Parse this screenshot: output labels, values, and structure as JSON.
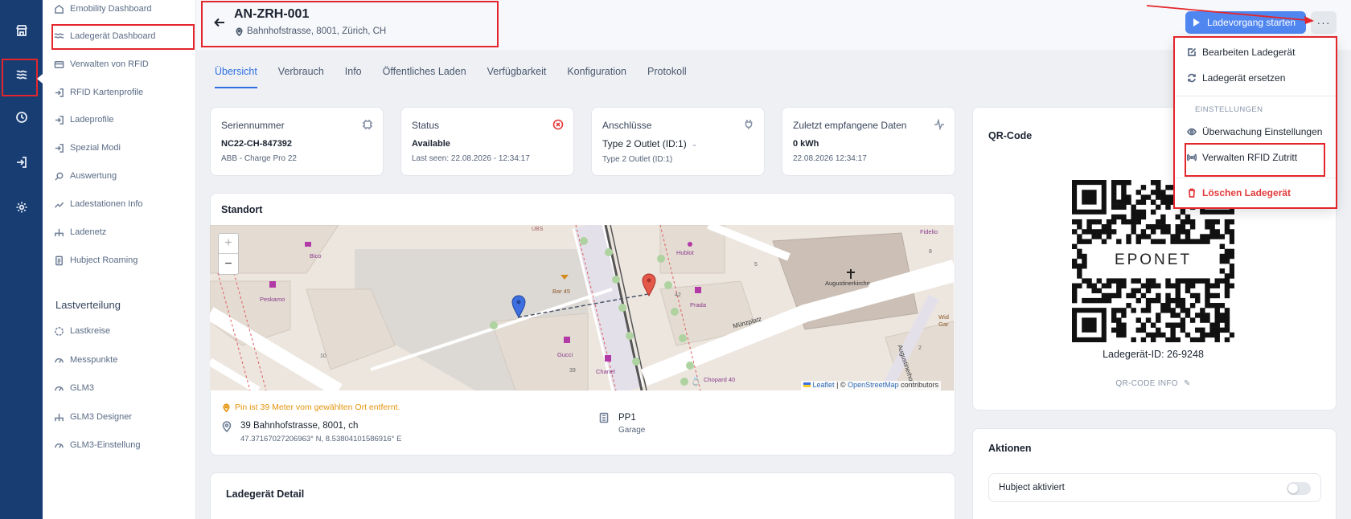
{
  "rail": {
    "items": [
      {
        "icon": "store-icon"
      },
      {
        "icon": "waves-icon",
        "active": true
      },
      {
        "icon": "clock-icon"
      },
      {
        "icon": "login-icon"
      },
      {
        "icon": "gear-icon"
      }
    ]
  },
  "sidebar": {
    "items": [
      {
        "label": "Emobility Dashboard",
        "icon": "home-icon"
      },
      {
        "label": "Ladegerät Dashboard",
        "icon": "waves-icon",
        "active": true
      },
      {
        "label": "Verwalten von RFID",
        "icon": "card-icon"
      },
      {
        "label": "RFID Kartenprofile",
        "icon": "login-icon"
      },
      {
        "label": "Ladeprofile",
        "icon": "login-icon"
      },
      {
        "label": "Spezial Modi",
        "icon": "login-icon"
      },
      {
        "label": "Auswertung",
        "icon": "search-icon"
      },
      {
        "label": "Ladestationen Info",
        "icon": "trend-icon"
      },
      {
        "label": "Ladenetz",
        "icon": "tree-icon"
      },
      {
        "label": "Hubject Roaming",
        "icon": "document-icon"
      }
    ],
    "section_title": "Lastverteilung",
    "section_items": [
      {
        "label": "Lastkreise",
        "icon": "circle-icon"
      },
      {
        "label": "Messpunkte",
        "icon": "gauge-icon"
      },
      {
        "label": "GLM3",
        "icon": "gauge-icon"
      },
      {
        "label": "GLM3 Designer",
        "icon": "tree-icon"
      },
      {
        "label": "GLM3-Einstellung",
        "icon": "gauge-icon"
      }
    ]
  },
  "header": {
    "title": "AN-ZRH-001",
    "address": "Bahnhofstrasse, 8001, Zürich, CH",
    "start_button": "Ladevorgang starten",
    "more_button": "···"
  },
  "tabs": [
    "Übersicht",
    "Verbrauch",
    "Info",
    "Öffentliches Laden",
    "Verfügbarkeit",
    "Konfiguration",
    "Protokoll"
  ],
  "cards": {
    "serial": {
      "label": "Seriennummer",
      "value": "NC22-CH-847392",
      "sub": "ABB - Charge Pro 22"
    },
    "status": {
      "label": "Status",
      "value": "Available",
      "sub": "Last seen: 22.08.2026 - 12:34:17"
    },
    "connectors": {
      "label": "Anschlüsse",
      "value": "Type 2 Outlet (ID:1)",
      "sub": "Type 2 Outlet (ID:1)"
    },
    "last_data": {
      "label": "Zuletzt empfangene Daten",
      "value": "0 kWh",
      "sub": "22.08.2026 12:34:17"
    }
  },
  "location": {
    "title": "Standort",
    "warning": "Pin ist 39 Meter vom gewählten Ort entfernt.",
    "address": "39 Bahnhofstrasse, 8001, ch",
    "coords": "47.37167027206963° N, 8.53804101586916° E",
    "parking": "PP1",
    "parking_type": "Garage",
    "map_labels": [
      "UBS",
      "Fidelio",
      "Hublot",
      "Bico",
      "Peskamo",
      "Bar 45",
      "Prada",
      "Augustinerkirche",
      "Münzplatz",
      "Gucci",
      "Chanel",
      "Chopard 40",
      "39",
      "10",
      "42",
      "5",
      "8",
      "2",
      "Augustinerhof",
      "Wid Gar"
    ],
    "zoom_in": "+",
    "zoom_out": "−",
    "attribution_leaflet": "Leaflet",
    "attribution_sep": "| ©",
    "attribution_osm": "OpenStreetMap",
    "attribution_rest": "contributors"
  },
  "detail": {
    "title": "Ladegerät Detail"
  },
  "qr": {
    "title": "QR-Code",
    "logo_text": "EPONET",
    "id_text": "Ladegerät-ID: 26-9248",
    "info_link": "QR-CODE INFO"
  },
  "actions": {
    "title": "Aktionen",
    "hubject_label": "Hubject aktiviert",
    "hubject_enabled": false
  },
  "menu": {
    "items": [
      {
        "label": "Bearbeiten Ladegerät",
        "icon": "edit-icon"
      },
      {
        "label": "Ladegerät ersetzen",
        "icon": "refresh-icon"
      }
    ],
    "group_label": "EINSTELLUNGEN",
    "group_items": [
      {
        "label": "Überwachung Einstellungen",
        "icon": "eye-icon"
      },
      {
        "label": "Verwalten RFID Zutritt",
        "icon": "broadcast-icon"
      }
    ],
    "delete_label": "Löschen Ladegerät"
  },
  "colors": {
    "rail": "#173d73",
    "accent": "#2f6fe0",
    "primary_button": "#4f86f0",
    "annotation_red": "#e3262b",
    "warning": "#e6930c",
    "danger": "#e23a3a"
  }
}
